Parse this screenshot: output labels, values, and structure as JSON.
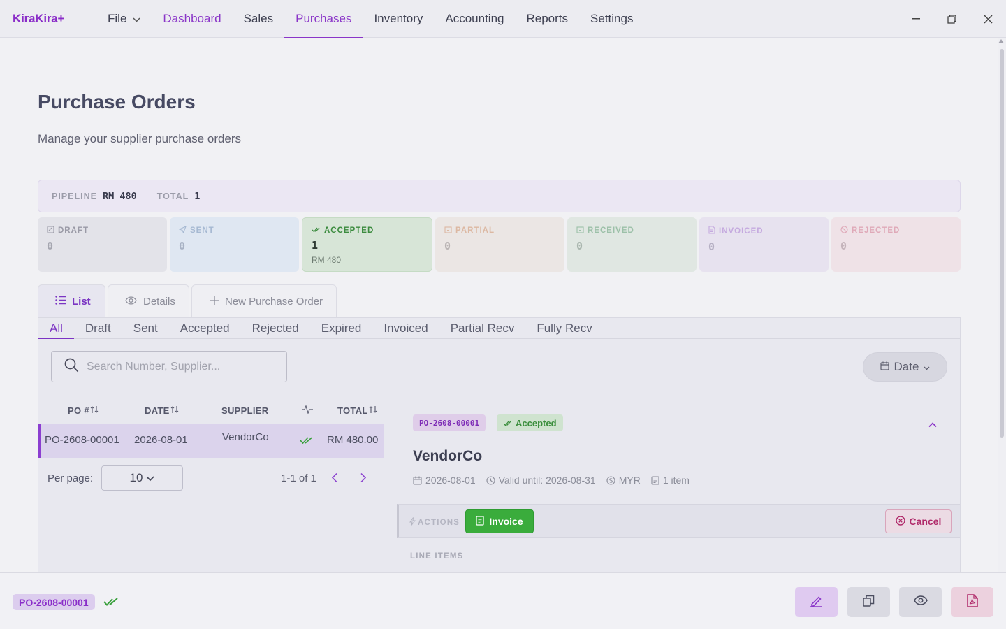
{
  "app": {
    "title": "KiraKira+"
  },
  "menu": {
    "file": "File",
    "items": [
      "Dashboard",
      "Sales",
      "Purchases",
      "Inventory",
      "Accounting",
      "Reports",
      "Settings"
    ],
    "active": "Purchases"
  },
  "page": {
    "title": "Purchase Orders",
    "subtitle": "Manage your supplier purchase orders"
  },
  "pipeline": {
    "pipeline_label": "PIPELINE",
    "pipeline_value": "RM 480",
    "total_label": "TOTAL",
    "total_value": "1"
  },
  "status_cards": [
    {
      "label": "DRAFT",
      "count": "0",
      "amount": ""
    },
    {
      "label": "SENT",
      "count": "0",
      "amount": ""
    },
    {
      "label": "ACCEPTED",
      "count": "1",
      "amount": "RM 480"
    },
    {
      "label": "PARTIAL",
      "count": "0",
      "amount": ""
    },
    {
      "label": "RECEIVED",
      "count": "0",
      "amount": ""
    },
    {
      "label": "INVOICED",
      "count": "0",
      "amount": ""
    },
    {
      "label": "REJECTED",
      "count": "0",
      "amount": ""
    }
  ],
  "view_tabs": {
    "list": "List",
    "details": "Details",
    "new": "New Purchase Order"
  },
  "filter_tabs": [
    "All",
    "Draft",
    "Sent",
    "Accepted",
    "Rejected",
    "Expired",
    "Invoiced",
    "Partial Recv",
    "Fully Recv"
  ],
  "search": {
    "placeholder": "Search Number, Supplier..."
  },
  "date_filter": {
    "label": "Date"
  },
  "table": {
    "headers": {
      "po": "PO #",
      "date": "DATE",
      "supplier": "SUPPLIER",
      "total": "TOTAL"
    },
    "rows": [
      {
        "po": "PO-2608-00001",
        "date": "2026-08-01",
        "supplier": "VendorCo",
        "total": "RM 480.00"
      }
    ]
  },
  "pagination": {
    "per_page_label": "Per page:",
    "per_page_value": "10",
    "range": "1-1 of 1"
  },
  "detail": {
    "po_number": "PO-2608-00001",
    "status": "Accepted",
    "supplier": "VendorCo",
    "date": "2026-08-01",
    "valid_until": "Valid until: 2026-08-31",
    "currency": "MYR",
    "items": "1 item",
    "actions_label": "ACTIONS",
    "invoice_label": "Invoice",
    "cancel_label": "Cancel",
    "line_items_label": "LINE ITEMS"
  },
  "footer": {
    "po_number": "PO-2608-00001"
  },
  "colors": {
    "accent": "#8a35c8",
    "success": "#3aac3c",
    "danger": "#b02a6a"
  }
}
